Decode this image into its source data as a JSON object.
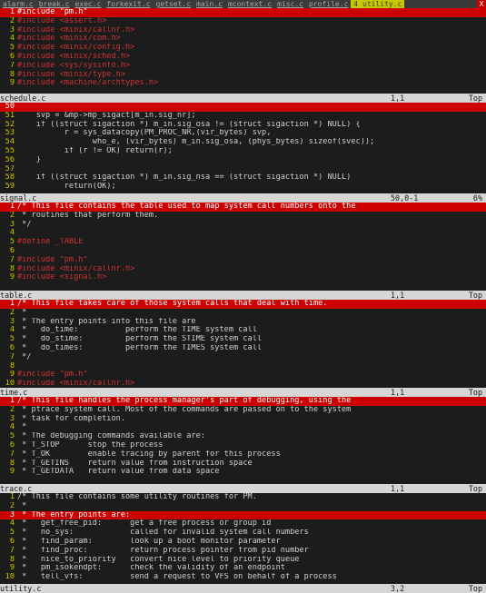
{
  "tabs": [
    {
      "label": "alarm.c",
      "active": false
    },
    {
      "label": "break.c",
      "active": false
    },
    {
      "label": "exec.c",
      "active": false
    },
    {
      "label": "forkexit.c",
      "active": false
    },
    {
      "label": "getset.c",
      "active": false
    },
    {
      "label": "main.c",
      "active": false
    },
    {
      "label": "mcontext.c",
      "active": false
    },
    {
      "label": "misc.c",
      "active": false
    },
    {
      "label": "profile.c",
      "active": false
    },
    {
      "label": "4 utility.c",
      "active": true
    }
  ],
  "tab_close": "X",
  "panes": [
    {
      "lines": [
        {
          "n": "1",
          "t": "#include \"pm.h\"",
          "hl": true
        },
        {
          "n": "2",
          "t": "#include <assert.h>"
        },
        {
          "n": "3",
          "t": "#include <minix/callnr.h>"
        },
        {
          "n": "4",
          "t": "#include <minix/com.h>"
        },
        {
          "n": "5",
          "t": "#include <minix/config.h>"
        },
        {
          "n": "6",
          "t": "#include <minix/sched.h>"
        },
        {
          "n": "7",
          "t": "#include <sys/sysinfo.h>"
        },
        {
          "n": "8",
          "t": "#include <minix/type.h>"
        },
        {
          "n": "9",
          "t": "#include <machine/archtypes.h>"
        }
      ],
      "status": {
        "file": "schedule.c",
        "pos": "1,1",
        "pct": "Top"
      }
    },
    {
      "lines": [
        {
          "n": "50",
          "t": "",
          "hl": true
        },
        {
          "n": "51",
          "t": "    svp = &mp->mp_sigact[m_in.sig_nr];"
        },
        {
          "n": "52",
          "t": "    if ((struct sigaction *) m_in.sig_osa != (struct sigaction *) NULL) {"
        },
        {
          "n": "53",
          "t": "          r = sys_datacopy(PM_PROC_NR,(vir_bytes) svp,"
        },
        {
          "n": "54",
          "t": "                who_e, (vir_bytes) m_in.sig_osa, (phys_bytes) sizeof(svec));"
        },
        {
          "n": "55",
          "t": "          if (r != OK) return(r);"
        },
        {
          "n": "56",
          "t": "    }"
        },
        {
          "n": "57",
          "t": ""
        },
        {
          "n": "58",
          "t": "    if ((struct sigaction *) m_in.sig_nsa == (struct sigaction *) NULL)"
        },
        {
          "n": "59",
          "t": "          return(OK);"
        }
      ],
      "status": {
        "file": "signal.c",
        "pos": "50,0-1",
        "pct": "6%"
      }
    },
    {
      "lines": [
        {
          "n": "1",
          "t": "/* This file contains the table used to map system call numbers onto the",
          "hl": true
        },
        {
          "n": "2",
          "t": " * routines that perform them."
        },
        {
          "n": "3",
          "t": " */"
        },
        {
          "n": "4",
          "t": ""
        },
        {
          "n": "5",
          "t": "#define _TABLE"
        },
        {
          "n": "6",
          "t": ""
        },
        {
          "n": "7",
          "t": "#include \"pm.h\""
        },
        {
          "n": "8",
          "t": "#include <minix/callnr.h>"
        },
        {
          "n": "9",
          "t": "#include <signal.h>"
        }
      ],
      "status": {
        "file": "table.c",
        "pos": "1,1",
        "pct": "Top"
      }
    },
    {
      "lines": [
        {
          "n": "1",
          "t": "/* This file takes care of those system calls that deal with time.",
          "hl": true
        },
        {
          "n": "2",
          "t": " *"
        },
        {
          "n": "3",
          "t": " * The entry points into this file are"
        },
        {
          "n": "4",
          "t": " *   do_time:          perform the TIME system call"
        },
        {
          "n": "5",
          "t": " *   do_stime:         perform the STIME system call"
        },
        {
          "n": "6",
          "t": " *   do_times:         perform the TIMES system call"
        },
        {
          "n": "7",
          "t": " */"
        },
        {
          "n": "8",
          "t": ""
        },
        {
          "n": "9",
          "t": "#include \"pm.h\""
        },
        {
          "n": "10",
          "t": "#include <minix/callnr.h>"
        }
      ],
      "status": {
        "file": "time.c",
        "pos": "1,1",
        "pct": "Top"
      }
    },
    {
      "lines": [
        {
          "n": "1",
          "t": "/* This file handles the process manager's part of debugging, using the",
          "hl": true
        },
        {
          "n": "2",
          "t": " * ptrace system call. Most of the commands are passed on to the system"
        },
        {
          "n": "3",
          "t": " * task for completion."
        },
        {
          "n": "4",
          "t": " *"
        },
        {
          "n": "5",
          "t": " * The debugging commands available are:"
        },
        {
          "n": "6",
          "t": " * T_STOP      stop the process"
        },
        {
          "n": "7",
          "t": " * T_OK        enable tracing by parent for this process"
        },
        {
          "n": "8",
          "t": " * T_GETINS    return value from instruction space"
        },
        {
          "n": "9",
          "t": " * T_GETDATA   return value from data space"
        }
      ],
      "status": {
        "file": "trace.c",
        "pos": "1,1",
        "pct": "Top"
      }
    },
    {
      "lines": [
        {
          "n": "1",
          "t": "/* This file contains some utility routines for PM."
        },
        {
          "n": "2",
          "t": " *"
        },
        {
          "n": "3",
          "t": " * The entry points are:",
          "hl": true
        },
        {
          "n": "4",
          "t": " *   get_free_pid:      get a free process or group id"
        },
        {
          "n": "5",
          "t": " *   no_sys:            called for invalid system call numbers"
        },
        {
          "n": "6",
          "t": " *   find_param:        look up a boot monitor parameter"
        },
        {
          "n": "7",
          "t": " *   find_proc:         return process pointer from pid number"
        },
        {
          "n": "8",
          "t": " *   nice_to_priority   convert nice level to priority queue"
        },
        {
          "n": "9",
          "t": " *   pm_isokendpt:      check the validity of an endpoint"
        },
        {
          "n": "10",
          "t": " *   tell_vfs:          send a request to VFS on behalf of a process"
        }
      ],
      "status": {
        "file": "utility.c",
        "pos": "3,2",
        "pct": "Top"
      }
    }
  ]
}
